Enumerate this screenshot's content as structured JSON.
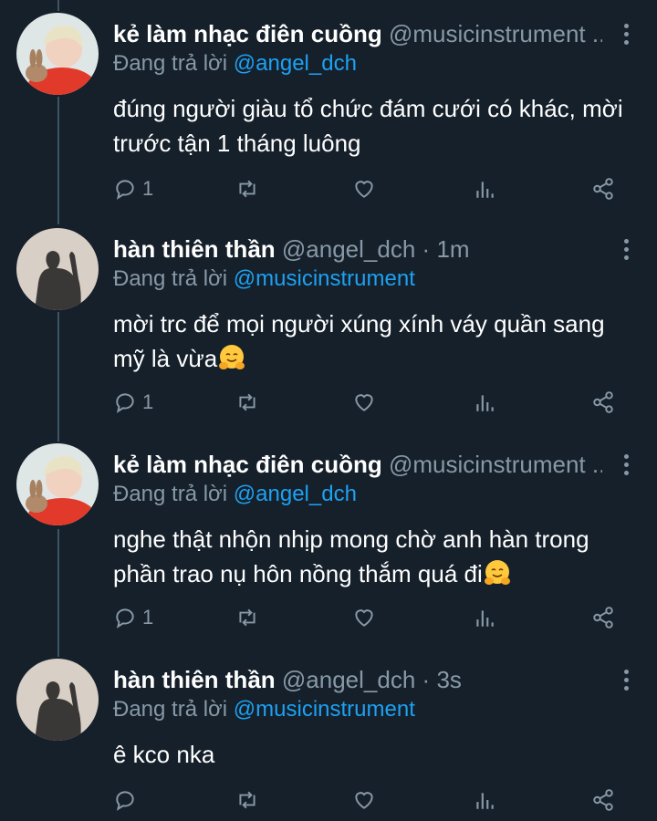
{
  "colors": {
    "background": "#15202b",
    "text": "#ffffff",
    "muted": "#8899a6",
    "link": "#1da1f2",
    "thread_line": "#3d5466"
  },
  "tweets": [
    {
      "name": "kẻ làm nhạc điên cuồng",
      "handle": "@musicinstrument ...",
      "time": "",
      "reply_prefix": "Đang trả lời",
      "reply_to": "@angel_dch",
      "text": "đúng người giàu tổ chức đám cưới có khác, mời trước tận 1 tháng luông",
      "emoji": "",
      "reply_count": "1",
      "avatar": "boy-with-rabbit"
    },
    {
      "name": "hàn thiên thần",
      "handle": "@angel_dch",
      "time": "1m",
      "reply_prefix": "Đang trả lời",
      "reply_to": "@musicinstrument",
      "text": "mời trc để mọi người xúng xính váy quần sang mỹ là vừa",
      "emoji": "hugging-face",
      "reply_count": "1",
      "avatar": "shadow-silhouette"
    },
    {
      "name": "kẻ làm nhạc điên cuồng",
      "handle": "@musicinstrument ...",
      "time": "",
      "reply_prefix": "Đang trả lời",
      "reply_to": "@angel_dch",
      "text": "nghe thật nhộn nhịp mong chờ anh hàn trong phần trao nụ hôn nồng thắm quá đi",
      "emoji": "hugging-face",
      "reply_count": "1",
      "avatar": "boy-with-rabbit"
    },
    {
      "name": "hàn thiên thần",
      "handle": "@angel_dch",
      "time": "3s",
      "reply_prefix": "Đang trả lời",
      "reply_to": "@musicinstrument",
      "text": "ê kco nka",
      "emoji": "",
      "reply_count": "",
      "avatar": "shadow-silhouette"
    }
  ]
}
